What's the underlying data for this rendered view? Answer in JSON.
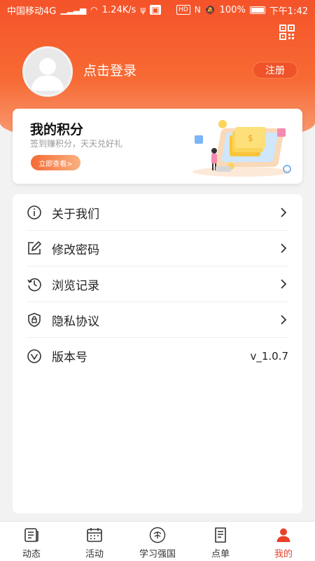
{
  "status_bar": {
    "carrier": "中国移动4G",
    "speed": "1.24K/s",
    "hd": "HD",
    "battery": "100%",
    "time": "下午1:42"
  },
  "header": {
    "login_text": "点击登录",
    "register_label": "注册"
  },
  "points_card": {
    "title": "我的积分",
    "subtitle": "签到赚积分，天天兑好礼",
    "button_label": "立即查看>"
  },
  "menu": {
    "items": [
      {
        "label": "关于我们",
        "icon": "info-icon"
      },
      {
        "label": "修改密码",
        "icon": "edit-icon"
      },
      {
        "label": "浏览记录",
        "icon": "clock-icon"
      },
      {
        "label": "隐私协议",
        "icon": "shield-lock-icon"
      },
      {
        "label": "版本号",
        "icon": "version-icon",
        "value": "v_1.0.7"
      }
    ]
  },
  "bottom_nav": {
    "items": [
      {
        "label": "动态",
        "icon": "news-icon"
      },
      {
        "label": "活动",
        "icon": "calendar-icon"
      },
      {
        "label": "学习强国",
        "icon": "study-logo-icon"
      },
      {
        "label": "点单",
        "icon": "order-icon"
      },
      {
        "label": "我的",
        "icon": "user-icon",
        "active": true
      }
    ]
  },
  "colors": {
    "accent": "#f5532a",
    "active_tab": "#e8412a"
  }
}
